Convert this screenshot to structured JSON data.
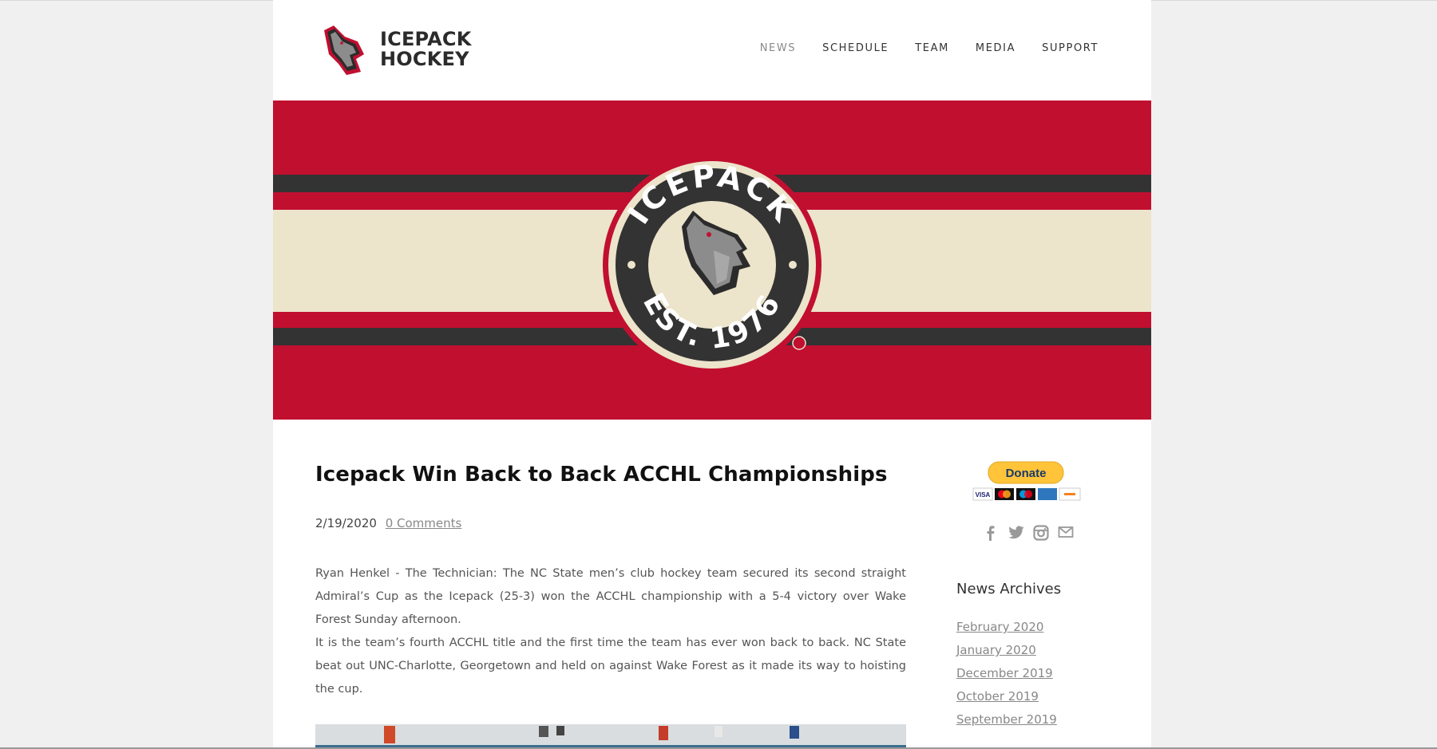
{
  "site": {
    "logo_text_line1": "ICEPACK",
    "logo_text_line2": "HOCKEY"
  },
  "nav": {
    "items": [
      {
        "label": "NEWS",
        "active": true
      },
      {
        "label": "SCHEDULE",
        "active": false
      },
      {
        "label": "TEAM",
        "active": false
      },
      {
        "label": "MEDIA",
        "active": false
      },
      {
        "label": "SUPPORT",
        "active": false
      }
    ]
  },
  "banner": {
    "badge_top_text": "ICEPACK",
    "badge_bottom_text": "EST. 1976",
    "colors": {
      "red": "#c10f30",
      "charcoal": "#333333",
      "cream": "#ece4cb"
    }
  },
  "article": {
    "title": "Icepack Win Back to Back ACCHL Championships",
    "date": "2/19/2020",
    "comments_link": "0 Comments",
    "paragraphs": [
      "Ryan Henkel - The Technician: The NC State men’s club hockey team secured its second straight Admiral’s Cup as the Icepack (25-3) won the ACCHL championship with a 5-4 victory over Wake Forest Sunday afternoon.",
      "It is the team’s fourth ACCHL title and the first time the team has ever won back to back. NC State beat out UNC-Charlotte, Georgetown and held on against Wake Forest as it made its way to hoisting the cup."
    ]
  },
  "sidebar": {
    "donate_label": "Donate",
    "card_labels": [
      "VISA",
      "MC",
      "MAESTRO",
      "AMEX",
      "DISCOVER"
    ],
    "social_icons": [
      "facebook-icon",
      "twitter-icon",
      "instagram-icon",
      "mail-icon"
    ],
    "archives_title": "News Archives",
    "archives": [
      "February 2020",
      "January 2020",
      "December 2019",
      "October 2019",
      "September 2019"
    ]
  }
}
